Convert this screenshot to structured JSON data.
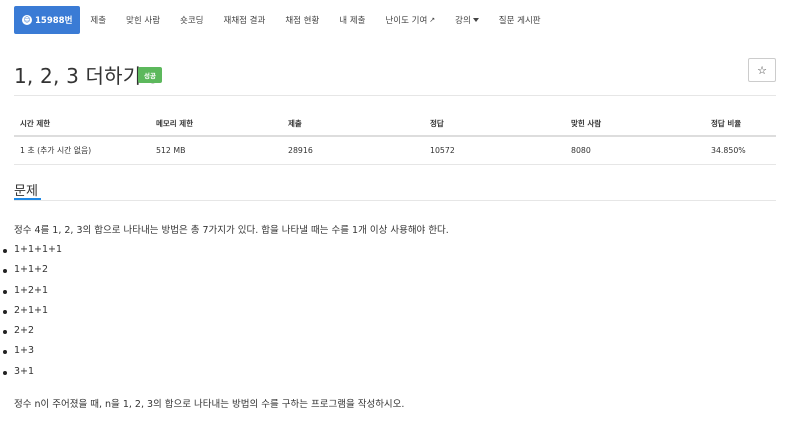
{
  "nav": {
    "items": [
      {
        "label": "15988번",
        "active": true
      },
      {
        "label": "제출"
      },
      {
        "label": "맞힌 사람"
      },
      {
        "label": "숏코딩"
      },
      {
        "label": "재채점 결과"
      },
      {
        "label": "채점 현황"
      },
      {
        "label": "내 제출"
      },
      {
        "label": "난이도 기여"
      },
      {
        "label": "강의"
      },
      {
        "label": "질문 게시판"
      }
    ]
  },
  "header": {
    "title": "1, 2, 3 더하기 3",
    "badge": "성공",
    "star_icon": "star-icon"
  },
  "stats": {
    "headers": [
      "시간 제한",
      "메모리 제한",
      "제출",
      "정답",
      "맞힌 사람",
      "정답 비율"
    ],
    "row": [
      "1 초 (추가 시간 없음)",
      "512 MB",
      "28916",
      "10572",
      "8080",
      "34.850%"
    ]
  },
  "problem": {
    "section_title": "문제",
    "intro": "정수 4를 1, 2, 3의 합으로 나타내는 방법은 총 7가지가 있다. 합을 나타낼 때는 수를 1개 이상 사용해야 한다.",
    "items": [
      "1+1+1+1",
      "1+1+2",
      "1+2+1",
      "2+1+1",
      "2+2",
      "1+3",
      "3+1"
    ],
    "question": "정수 n이 주어졌을 때, n을 1, 2, 3의 합으로 나타내는 방법의 수를 구하는 프로그램을 작성하시오."
  },
  "colors": {
    "accent": "#3a7bd5",
    "success_badge": "#5cb85c",
    "section_underline": "#1e88e5"
  }
}
